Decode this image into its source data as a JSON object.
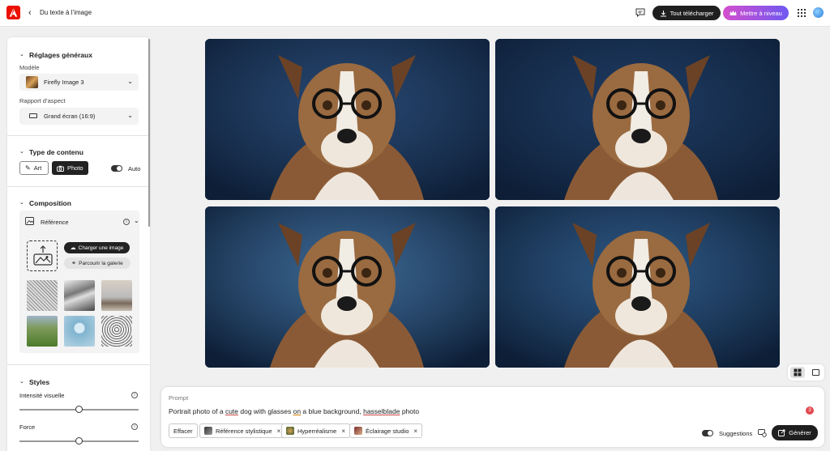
{
  "header": {
    "breadcrumb": "Du texte à l’image",
    "download_label": "Tout télécharger",
    "upgrade_label": "Mettre à niveau",
    "brand_color": "#eb1000",
    "upgrade_gradient": [
      "#d44fce",
      "#6f58f0"
    ]
  },
  "panel": {
    "general": {
      "title": "Réglages généraux",
      "model_label": "Modèle",
      "model_value": "Firefly Image 3",
      "ratio_label": "Rapport d’aspect",
      "ratio_value": "Grand écran (16:9)"
    },
    "content_type": {
      "title": "Type de contenu",
      "art_label": "Art",
      "photo_label": "Photo",
      "selected": "Photo",
      "auto_label": "Auto",
      "auto_on": true
    },
    "composition": {
      "title": "Composition",
      "reference_label": "Référence",
      "upload_label": "Charger une image",
      "gallery_label": "Parcourir la galerie",
      "thumbnails": [
        "sketch-bird",
        "winding-river",
        "living-room",
        "green-road",
        "blue-sphere",
        "owl-sketch"
      ]
    },
    "styles": {
      "title": "Styles",
      "intensity_label": "Intensité visuelle",
      "intensity_value": 0.5,
      "force_label": "Force",
      "force_value": 0.5
    }
  },
  "images": [
    {
      "name": "dog-glasses-1",
      "bg": "#27466f"
    },
    {
      "name": "dog-glasses-2",
      "bg": "#1e3a60"
    },
    {
      "name": "dog-glasses-3",
      "bg": "#3a6590"
    },
    {
      "name": "dog-glasses-4",
      "bg": "#2c5580"
    }
  ],
  "prompt": {
    "label": "Prompt",
    "text_parts": [
      "Portrait photo of a ",
      "cute",
      " dog with glasses ",
      "on",
      " a blue background, ",
      "hasselblade",
      " photo"
    ],
    "badge_count": "3",
    "clear_label": "Effacer",
    "chips": [
      "Référence stylistique",
      "Hyperréalisme",
      "Éclairage studio"
    ],
    "suggestions_label": "Suggestions",
    "suggestions_on": true,
    "generate_label": "Générer"
  }
}
